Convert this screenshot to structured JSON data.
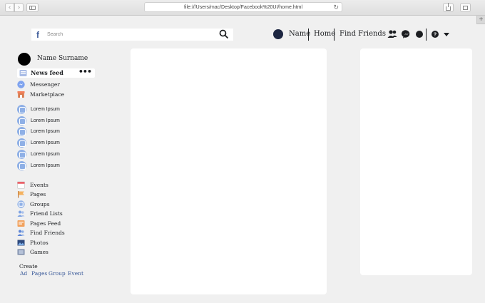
{
  "browser": {
    "url": "file:///Users/mac/Desktop/Facebook%20UI/home.html",
    "new_tab_label": "+"
  },
  "header": {
    "logo_text": "f",
    "search_placeholder": "Search",
    "user_name": "Name",
    "home_label": "Home",
    "find_friends_label": "Find Friends"
  },
  "sidebar": {
    "profile_name": "Name Surname",
    "news_feed_label": "News feed",
    "more_label": "•••",
    "primary": [
      {
        "label": "Messenger",
        "icon": "messenger-icon"
      },
      {
        "label": "Marketplace",
        "icon": "marketplace-icon"
      }
    ],
    "groups": [
      {
        "label": "Lorem Ipsum"
      },
      {
        "label": "Lorem Ipsum"
      },
      {
        "label": "Lorem Ipsum"
      },
      {
        "label": "Lorem Ipsum"
      },
      {
        "label": "Lorem Ipsum"
      },
      {
        "label": "Lorem Ipsum"
      }
    ],
    "explore": [
      {
        "label": "Events",
        "icon": "calendar-icon"
      },
      {
        "label": "Pages",
        "icon": "flag-icon"
      },
      {
        "label": "Groups",
        "icon": "groups-icon"
      },
      {
        "label": "Friend Lists",
        "icon": "friend-lists-icon"
      },
      {
        "label": "Pages Feed",
        "icon": "pages-feed-icon"
      },
      {
        "label": "Find Friends",
        "icon": "find-friends-icon"
      },
      {
        "label": "Photos",
        "icon": "photos-icon"
      },
      {
        "label": "Games",
        "icon": "games-icon"
      }
    ],
    "create_label": "Create",
    "create_links": [
      "Ad",
      "Pages",
      "Group",
      "Event"
    ]
  },
  "colors": {
    "brand": "#3b5998",
    "link": "#385898",
    "avatar": "#1c2540",
    "background": "#f0f0f0"
  }
}
